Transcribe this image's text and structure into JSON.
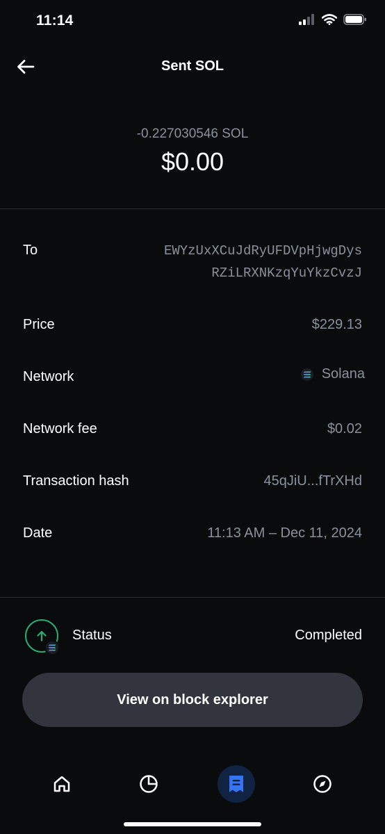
{
  "status_bar": {
    "time": "11:14",
    "icons": [
      "cellular-signal-icon",
      "wifi-icon",
      "battery-icon"
    ]
  },
  "header": {
    "back_icon": "arrow-left-icon",
    "title": "Sent SOL"
  },
  "amount": {
    "crypto": "-0.227030546 SOL",
    "fiat": "$0.00"
  },
  "details": {
    "to_label": "To",
    "to_address_line1": "EWYzUxXCuJdRyUFDVpHjwgDys",
    "to_address_line2": "RZiLRXNKzqYuYkzCvzJ",
    "price_label": "Price",
    "price_value": "$229.13",
    "network_label": "Network",
    "network_value": "Solana",
    "network_icon": "solana-logo-icon",
    "fee_label": "Network fee",
    "fee_value": "$0.02",
    "hash_label": "Transaction hash",
    "hash_value": "45qJiU...fTrXHd",
    "date_label": "Date",
    "date_value": "11:13 AM – Dec 11, 2024"
  },
  "status": {
    "icon": "arrow-up-icon",
    "label": "Status",
    "value": "Completed"
  },
  "actions": {
    "explorer_label": "View on block explorer"
  },
  "tabbar": {
    "tabs": [
      {
        "icon": "home-icon",
        "active": false
      },
      {
        "icon": "pie-chart-icon",
        "active": false
      },
      {
        "icon": "receipt-icon",
        "active": true
      },
      {
        "icon": "compass-icon",
        "active": false
      }
    ]
  },
  "colors": {
    "background": "#0a0b0d",
    "muted_text": "#8a919e",
    "success": "#27ad75",
    "button": "#32353d",
    "active_tab": "#102342",
    "accent_blue": "#3773f5"
  }
}
